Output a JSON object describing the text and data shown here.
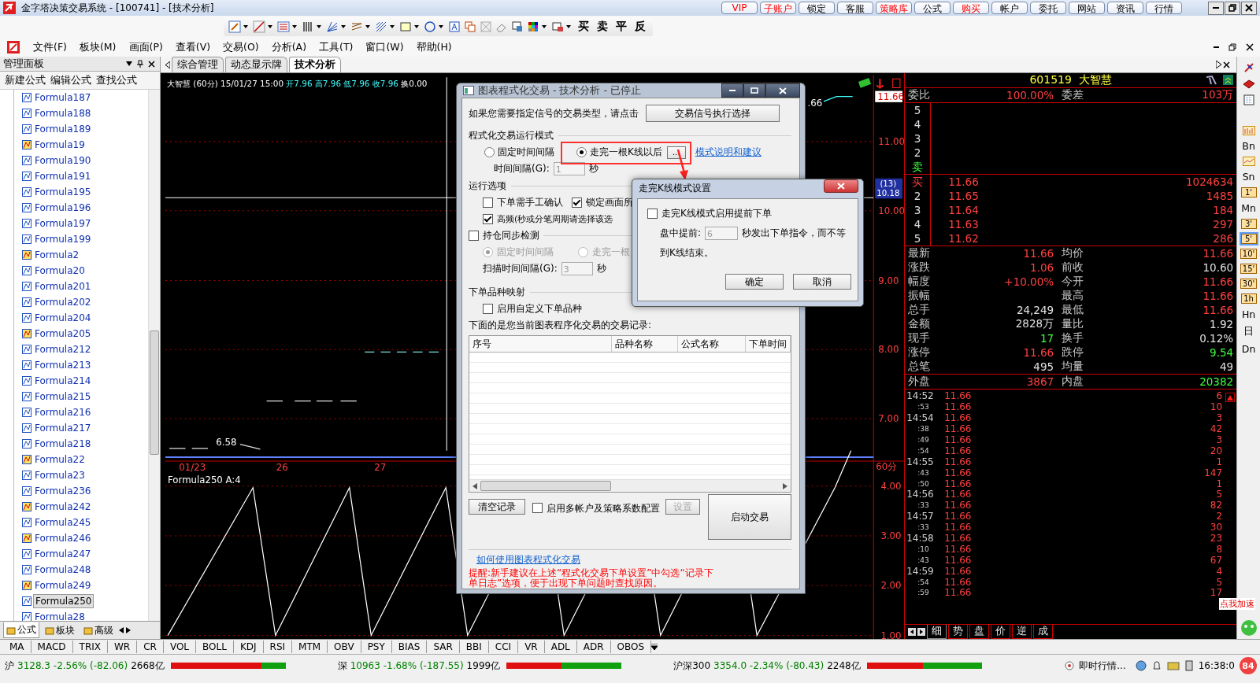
{
  "window": {
    "title": "金字塔决策交易系统 - [100741] - [技术分析]"
  },
  "top_buttons": [
    {
      "label": "VIP",
      "kind": "promo"
    },
    {
      "label": "子账户",
      "kind": "promo"
    },
    {
      "label": "锁定",
      "kind": "normal"
    },
    {
      "label": "客服",
      "kind": "normal"
    },
    {
      "label": "策略库",
      "kind": "promo"
    },
    {
      "label": "公式",
      "kind": "normal"
    },
    {
      "label": "购买",
      "kind": "promo"
    },
    {
      "label": "帐户",
      "kind": "normal"
    },
    {
      "label": "委托",
      "kind": "normal"
    },
    {
      "label": "网站",
      "kind": "normal"
    },
    {
      "label": "资讯",
      "kind": "normal"
    },
    {
      "label": "行情",
      "kind": "normal"
    }
  ],
  "trade_buttons": [
    "买",
    "卖",
    "平",
    "反"
  ],
  "menu": [
    "文件(F)",
    "板块(M)",
    "画面(P)",
    "查看(V)",
    "交易(O)",
    "分析(A)",
    "工具(T)",
    "窗口(W)",
    "帮助(H)"
  ],
  "panel": {
    "title": "管理面板",
    "actions": [
      "新建公式",
      "编辑公式",
      "查找公式"
    ],
    "items": [
      {
        "label": "Formula187",
        "kind": "plain",
        "selected": false
      },
      {
        "label": "Formula188",
        "kind": "plain",
        "selected": false
      },
      {
        "label": "Formula189",
        "kind": "plain",
        "selected": false
      },
      {
        "label": "Formula19",
        "kind": "color",
        "selected": false
      },
      {
        "label": "Formula190",
        "kind": "plain",
        "selected": false
      },
      {
        "label": "Formula191",
        "kind": "plain",
        "selected": false
      },
      {
        "label": "Formula195",
        "kind": "plain",
        "selected": false
      },
      {
        "label": "Formula196",
        "kind": "plain",
        "selected": false
      },
      {
        "label": "Formula197",
        "kind": "plain",
        "selected": false
      },
      {
        "label": "Formula199",
        "kind": "plain",
        "selected": false
      },
      {
        "label": "Formula2",
        "kind": "color",
        "selected": false
      },
      {
        "label": "Formula20",
        "kind": "plain",
        "selected": false
      },
      {
        "label": "Formula201",
        "kind": "plain",
        "selected": false
      },
      {
        "label": "Formula202",
        "kind": "plain",
        "selected": false
      },
      {
        "label": "Formula204",
        "kind": "plain",
        "selected": false
      },
      {
        "label": "Formula205",
        "kind": "color",
        "selected": false
      },
      {
        "label": "Formula212",
        "kind": "plain",
        "selected": false
      },
      {
        "label": "Formula213",
        "kind": "plain",
        "selected": false
      },
      {
        "label": "Formula214",
        "kind": "plain",
        "selected": false
      },
      {
        "label": "Formula215",
        "kind": "plain",
        "selected": false
      },
      {
        "label": "Formula216",
        "kind": "plain",
        "selected": false
      },
      {
        "label": "Formula217",
        "kind": "plain",
        "selected": false
      },
      {
        "label": "Formula218",
        "kind": "plain",
        "selected": false
      },
      {
        "label": "Formula22",
        "kind": "color",
        "selected": false
      },
      {
        "label": "Formula23",
        "kind": "plain",
        "selected": false
      },
      {
        "label": "Formula236",
        "kind": "plain",
        "selected": false
      },
      {
        "label": "Formula242",
        "kind": "color",
        "selected": false
      },
      {
        "label": "Formula245",
        "kind": "plain",
        "selected": false
      },
      {
        "label": "Formula246",
        "kind": "color",
        "selected": false
      },
      {
        "label": "Formula247",
        "kind": "plain",
        "selected": false
      },
      {
        "label": "Formula248",
        "kind": "plain",
        "selected": false
      },
      {
        "label": "Formula249",
        "kind": "color",
        "selected": false
      },
      {
        "label": "Formula250",
        "kind": "plain",
        "selected": true
      },
      {
        "label": "Formula28",
        "kind": "plain",
        "selected": false
      }
    ],
    "tabs": [
      {
        "label": "公式",
        "selected": true
      },
      {
        "label": "板块",
        "selected": false
      },
      {
        "label": "高级",
        "selected": false
      }
    ]
  },
  "doc_tabs": [
    {
      "label": "综合管理",
      "selected": false
    },
    {
      "label": "动态显示牌",
      "selected": false
    },
    {
      "label": "技术分析",
      "selected": true
    }
  ],
  "chart": {
    "header": [
      {
        "text": "大智慧 (60分) 15/01/27 15:00 ",
        "color": "#ffffff"
      },
      {
        "text": "开7.96 高7.96 低7.96 收7.96 ",
        "color": "#40ffff"
      },
      {
        "text": "换0.00",
        "color": "#ffffff"
      }
    ],
    "last_label": ".66",
    "low_label": "6.58",
    "dates": [
      "01/23",
      "26",
      "27"
    ],
    "price_axis": [
      {
        "kind": "current",
        "text": "11.66"
      },
      {
        "kind": "tick",
        "text": "11.00"
      },
      {
        "kind": "cursor",
        "note": "(13)",
        "text": "10.18"
      },
      {
        "kind": "tick",
        "text": "10.00"
      },
      {
        "kind": "tick",
        "text": "9.00"
      },
      {
        "kind": "tick",
        "text": "8.00"
      },
      {
        "kind": "tick",
        "text": "7.00"
      }
    ],
    "indicator": {
      "title": "Formula250 A:4",
      "period": "60分",
      "axis": [
        "4.00",
        "3.00",
        "2.00",
        "1.00"
      ]
    }
  },
  "quote": {
    "code": "601519",
    "name": "大智慧",
    "ratio": {
      "label": "委比",
      "value": "100.00%",
      "label2": "委差",
      "value2": "103万"
    },
    "sell": [
      {
        "label": "5",
        "color": "#e0e0e0"
      },
      {
        "label": "4",
        "color": "#e0e0e0"
      },
      {
        "label": "3",
        "color": "#e0e0e0"
      },
      {
        "label": "2",
        "color": "#e0e0e0"
      },
      {
        "label": "卖",
        "color": "#40ff40"
      }
    ],
    "buy": [
      {
        "label": "买",
        "color": "#ff4040",
        "price": "11.66",
        "volume": "1024634"
      },
      {
        "label": "2",
        "color": "#e0e0e0",
        "price": "11.65",
        "volume": "1485"
      },
      {
        "label": "3",
        "color": "#e0e0e0",
        "price": "11.64",
        "volume": "184"
      },
      {
        "label": "4",
        "color": "#e0e0e0",
        "price": "11.63",
        "volume": "297"
      },
      {
        "label": "5",
        "color": "#e0e0e0",
        "price": "11.62",
        "volume": "286"
      }
    ],
    "stats": [
      {
        "left": {
          "label": "最新",
          "value": "11.66",
          "color": "#ff4040"
        },
        "right": {
          "label": "均价",
          "value": "11.66",
          "color": "#ff4040"
        }
      },
      {
        "left": {
          "label": "涨跌",
          "value": "1.06",
          "color": "#ff4040"
        },
        "right": {
          "label": "前收",
          "value": "10.60",
          "color": "#e0e0e0"
        }
      },
      {
        "left": {
          "label": "幅度",
          "value": "+10.00%",
          "color": "#ff4040"
        },
        "right": {
          "label": "今开",
          "value": "11.66",
          "color": "#ff4040"
        }
      },
      {
        "left": {
          "label": "振幅"
        },
        "right": {
          "label": "最高",
          "value": "11.66",
          "color": "#ff4040"
        }
      },
      {
        "left": {
          "label": "总手",
          "value": "24,249",
          "color": "#e0e0e0"
        },
        "right": {
          "label": "最低",
          "value": "11.66",
          "color": "#ff4040"
        }
      },
      {
        "left": {
          "label": "金额",
          "value": "2828万",
          "color": "#e0e0e0"
        },
        "right": {
          "label": "量比",
          "value": "1.92",
          "color": "#e0e0e0"
        }
      },
      {
        "left": {
          "label": "现手",
          "value": "17",
          "color": "#40ff40"
        },
        "right": {
          "label": "换手",
          "value": "0.12%",
          "color": "#e0e0e0"
        }
      },
      {
        "left": {
          "label": "涨停",
          "value": "11.66",
          "color": "#ff4040"
        },
        "right": {
          "label": "跌停",
          "value": "9.54",
          "color": "#40ff40"
        }
      },
      {
        "left": {
          "label": "总笔",
          "value": "495",
          "color": "#e0e0e0"
        },
        "right": {
          "label": "均量",
          "value": "49",
          "color": "#e0e0e0"
        }
      }
    ],
    "outer": {
      "label": "外盘",
      "value": "3867",
      "label2": "内盘",
      "value2": "20382"
    },
    "ticks": [
      {
        "time": "14:52",
        "price": "11.66",
        "volume": "6"
      },
      {
        "time": ":53",
        "price": "11.66",
        "volume": "10"
      },
      {
        "time": "14:54",
        "price": "11.66",
        "volume": "3"
      },
      {
        "time": ":38",
        "price": "11.66",
        "volume": "42"
      },
      {
        "time": ":49",
        "price": "11.66",
        "volume": "3"
      },
      {
        "time": ":54",
        "price": "11.66",
        "volume": "20"
      },
      {
        "time": "14:55",
        "price": "11.66",
        "volume": "1"
      },
      {
        "time": ":43",
        "price": "11.66",
        "volume": "147"
      },
      {
        "time": ":50",
        "price": "11.66",
        "volume": "1"
      },
      {
        "time": "14:56",
        "price": "11.66",
        "volume": "5"
      },
      {
        "time": ":33",
        "price": "11.66",
        "volume": "82"
      },
      {
        "time": "14:57",
        "price": "11.66",
        "volume": "2"
      },
      {
        "time": ":33",
        "price": "11.66",
        "volume": "30"
      },
      {
        "time": "14:58",
        "price": "11.66",
        "volume": "23"
      },
      {
        "time": ":10",
        "price": "11.66",
        "volume": "8"
      },
      {
        "time": ":43",
        "price": "11.66",
        "volume": "67"
      },
      {
        "time": "14:59",
        "price": "11.66",
        "volume": "4"
      },
      {
        "time": ":54",
        "price": "11.66",
        "volume": "5"
      },
      {
        "time": ":59",
        "price": "11.66",
        "volume": "17"
      }
    ],
    "tabs": [
      {
        "label": "细",
        "selected": true
      },
      {
        "label": "势",
        "selected": false
      },
      {
        "label": "盘",
        "selected": false
      },
      {
        "label": "价",
        "selected": false
      },
      {
        "label": "逆",
        "selected": false
      },
      {
        "label": "成",
        "selected": false
      }
    ]
  },
  "periods": [
    {
      "label": "Bn",
      "kind": "plain",
      "selected": false
    },
    {
      "label": "Sn",
      "kind": "plain",
      "selected": false
    },
    {
      "label": "1'",
      "kind": "boxed",
      "selected": false
    },
    {
      "label": "Mn",
      "kind": "plain",
      "selected": false
    },
    {
      "label": "3'",
      "kind": "boxed",
      "selected": false
    },
    {
      "label": "5'",
      "kind": "boxed",
      "selected": true
    },
    {
      "label": "10'",
      "kind": "boxed",
      "selected": false
    },
    {
      "label": "15'",
      "kind": "boxed",
      "selected": false
    },
    {
      "label": "30'",
      "kind": "boxed",
      "selected": false
    },
    {
      "label": "1h",
      "kind": "boxed",
      "selected": false
    },
    {
      "label": "Hn",
      "kind": "plain",
      "selected": false
    },
    {
      "label": "日",
      "kind": "plain",
      "selected": false
    },
    {
      "label": "Dn",
      "kind": "plain",
      "selected": false
    }
  ],
  "promo": {
    "text": "点我加速",
    "badge": "84"
  },
  "indicators": [
    "MA",
    "MACD",
    "TRIX",
    "WR",
    "CR",
    "VOL",
    "BOLL",
    "KDJ",
    "RSI",
    "MTM",
    "OBV",
    "PSY",
    "BIAS",
    "SAR",
    "BBI",
    "CCI",
    "VR",
    "ADL",
    "ADR",
    "OBOS"
  ],
  "status": {
    "indices": [
      {
        "name": "沪",
        "quote": "3128.3 -2.56% (-82.06)",
        "amount": "2668亿",
        "level": 0.79
      },
      {
        "name": "深",
        "quote": "10963 -1.68% (-187.55)",
        "amount": "1999亿",
        "level": 0.48
      },
      {
        "name": "沪深300",
        "quote": "3354.0 -2.34% (-80.43)",
        "amount": "2248亿",
        "level": 0.49
      }
    ],
    "feed": "即时行情...",
    "clock": "16:38:0"
  },
  "dialog": {
    "title": "图表程式化交易 - 技术分析 - 已停止",
    "prompt": "如果您需要指定信号的交易类型，请点击",
    "signal_button": "交易信号执行选择",
    "mode_group": "程式化交易运行模式",
    "modes": [
      {
        "label": "固定时间间隔",
        "selected": false
      },
      {
        "label": "走完一根K线以后",
        "selected": true
      }
    ],
    "more_button": "...",
    "mode_link": "模式说明和建议",
    "interval_label": "时间间隔(G):",
    "interval_value": "1",
    "interval_unit": "秒",
    "options_group": "运行选项",
    "options": [
      {
        "label": "下单需手工确认",
        "checked": false
      },
      {
        "label": "锁定画面所",
        "checked": true
      },
      {
        "label": "高频(秒或分笔周期请选择该选",
        "checked": true
      }
    ],
    "sync": {
      "label": "持仓同步检测",
      "checked": false
    },
    "sync_modes": [
      {
        "label": "固定时间间隔",
        "selected": true
      },
      {
        "label": "走完一根",
        "selected": false
      }
    ],
    "scan_label": "扫描时间间隔(G):",
    "scan_value": "3",
    "scan_unit": "秒",
    "map_group": "下单品种映射",
    "map_option": {
      "label": "启用自定义下单品种",
      "checked": false
    },
    "records_label": "下面的是您当前图表程序化交易的交易记录:",
    "columns": [
      "序号",
      "品种名称",
      "公式名称",
      "下单时间"
    ],
    "clear_button": "清空记录",
    "multi": {
      "label": "启用多帐户及策略系数配置",
      "checked": false
    },
    "settings_button": {
      "label": "设置",
      "disabled": true
    },
    "start_button": "启动交易",
    "help_link": "如何使用图表程式化交易",
    "tip": "提醒:新手建议在上述“程式化交易下单设置”中勾选“记录下单日志”选项，便于出现下单问题时查找原因。"
  },
  "subdialog": {
    "title": "走完K线模式设置",
    "option": {
      "label": "走完K线模式启用提前下单",
      "checked": false
    },
    "ahead_label": "盘中提前:",
    "ahead_value": "6",
    "ahead_text": "秒发出下单指令，而不等",
    "ahead_text2": "到K线结束。",
    "ok": "确定",
    "cancel": "取消"
  }
}
